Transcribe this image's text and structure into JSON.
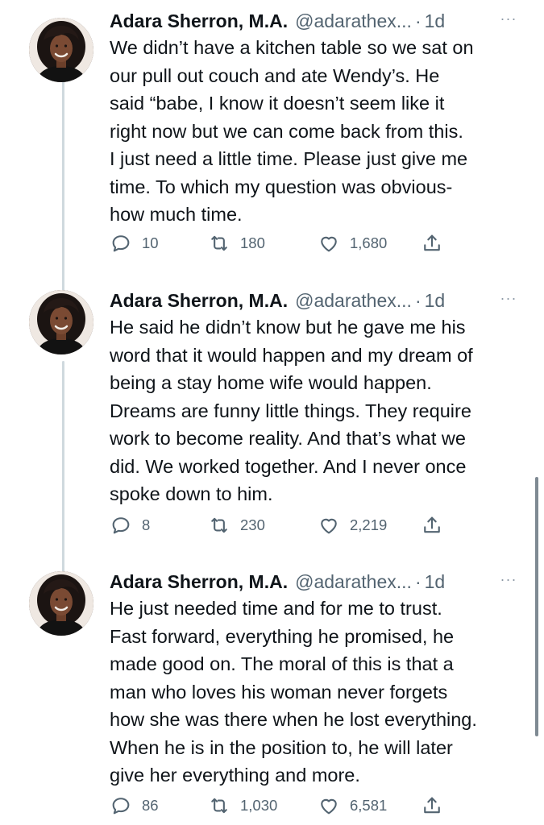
{
  "colors": {
    "text": "#0f1419",
    "muted": "#536471",
    "thread": "#cfd9de"
  },
  "tweets": [
    {
      "name": "Adara Sherron, M.A.",
      "handle": "@adarathex...",
      "dot": "·",
      "time": "1d",
      "more": "···",
      "text": "We didn’t have a kitchen table so we sat on\nour pull out couch and ate Wendy’s. He\nsaid “babe, I know it doesn’t seem like it\nright now but we can come back from this.\nI just need a little time. Please just give me\ntime. To which my question was obvious-\nhow much time.",
      "replies": "10",
      "retweets": "180",
      "likes": "1,680"
    },
    {
      "name": "Adara Sherron, M.A.",
      "handle": "@adarathex...",
      "dot": "·",
      "time": "1d",
      "more": "···",
      "text": "He said he didn’t know but he gave me his\nword that it would happen and my dream of\nbeing a stay home wife would happen.\nDreams are funny little things. They require\nwork to become reality. And that’s what we\ndid. We worked together. And I never once\nspoke down to him.",
      "replies": "8",
      "retweets": "230",
      "likes": "2,219"
    },
    {
      "name": "Adara Sherron, M.A.",
      "handle": "@adarathex...",
      "dot": "·",
      "time": "1d",
      "more": "···",
      "text": "He just needed time and for me to trust.\nFast forward, everything he promised, he\nmade good on. The moral of this is that a\nman who loves his woman never forgets\nhow she was there when he lost everything.\nWhen he is in the position to, he will later\ngive her everything and more.",
      "replies": "86",
      "retweets": "1,030",
      "likes": "6,581"
    }
  ],
  "icons": [
    "reply-icon",
    "retweet-icon",
    "like-icon",
    "share-icon"
  ]
}
